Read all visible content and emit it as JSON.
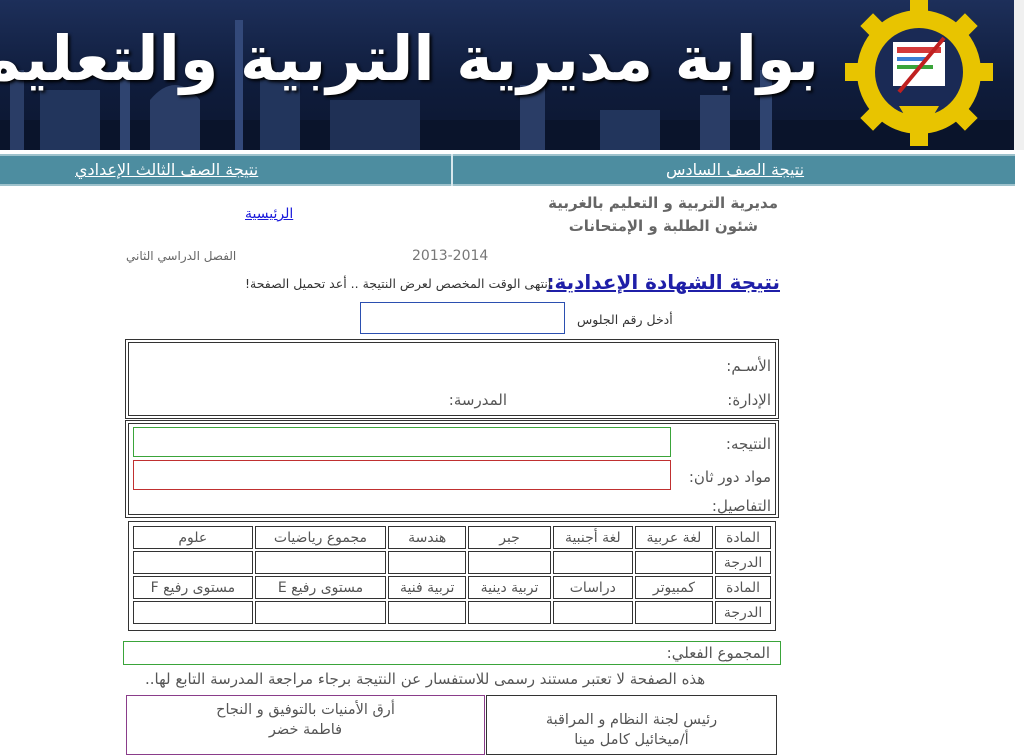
{
  "banner": {
    "title": "بوابة مديرية التربية والتعليم بالغربية"
  },
  "nav": {
    "sixth_grade_link": "نتيجة الصف السادس",
    "third_prep_link": "نتيجة الصف الثالث الإعدادي"
  },
  "header": {
    "line1": "مديرية التربية و التعليم بالغربية",
    "line2": "شئون الطلبة و الإمتحانات",
    "home_link": "الرئيسية"
  },
  "term": {
    "year": "2013-2014",
    "semester": "الفصل الدراسي الثاني"
  },
  "result_form": {
    "title": "نتيجة الشهادة الإعدادية:",
    "time_expired_message": "إنتهى الوقت المخصص لعرض النتيجة .. أعد تحميل الصفحة!",
    "seat_label": "أدخل رقم الجلوس",
    "seat_value": ""
  },
  "student": {
    "name_label": "الأسـم:",
    "administration_label": "الإدارة:",
    "school_label": "المدرسة:"
  },
  "result": {
    "result_label": "النتيجه:",
    "second_round_label": "مواد دور ثان:",
    "details_label": "التفاصيل:"
  },
  "grades": {
    "row1_subjects": [
      "المادة",
      "لغة عربية",
      "لغة أجنبية",
      "جبر",
      "هندسة",
      "مجموع رياضيات",
      "علوم"
    ],
    "row2_grades": [
      "الدرجة",
      "",
      "",
      "",
      "",
      "",
      ""
    ],
    "row3_subjects": [
      "المادة",
      "كمبيوتر",
      "دراسات",
      "تربية دينية",
      "تربية فنية",
      "مستوى رفيع E",
      "مستوى رفيع F"
    ],
    "row4_grades": [
      "الدرجة",
      "",
      "",
      "",
      "",
      "",
      ""
    ]
  },
  "total": {
    "label": "المجموع الفعلي:"
  },
  "footer": {
    "disclaimer": "هذه الصفحة لا تعتبر مستند رسمى للاستفسار عن النتيجة برجاء مراجعة المدرسة التابع لها..",
    "right_sig_title": "رئيس لجنة النظام و المراقبة",
    "right_sig_name": "أ/ميخائيل كامل مينا",
    "left_sig_wish": "أرق الأمنيات بالتوفيق و النجاح",
    "left_sig_name": "فاطمة خضر"
  },
  "colors": {
    "nav_bg": "#4d8da0",
    "title_blue": "#1f1fa8",
    "link_blue": "#1a1adb",
    "result_border_green": "#3aa43a",
    "second_round_border_red": "#c03030",
    "seat_border_blue": "#2b4fb0"
  }
}
